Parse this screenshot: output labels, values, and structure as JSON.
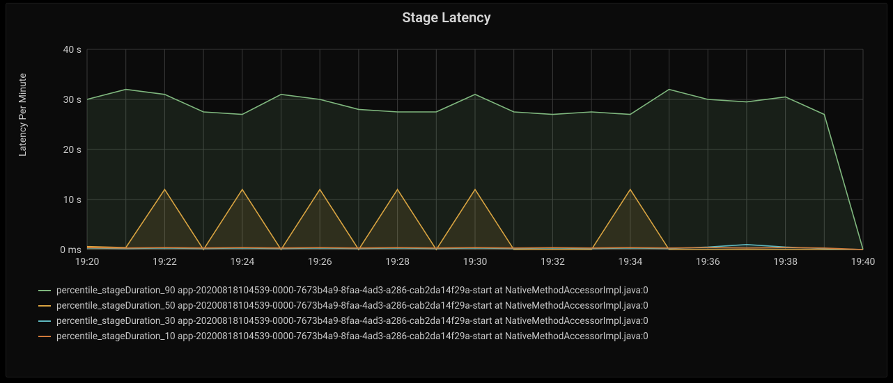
{
  "title": "Stage Latency",
  "ylabel": "Latency Per Minute",
  "chart_data": {
    "type": "area",
    "xlabel": "",
    "ylabel": "Latency Per Minute",
    "title": "Stage Latency",
    "x_ticks": [
      "19:20",
      "19:22",
      "19:24",
      "19:26",
      "19:28",
      "19:30",
      "19:32",
      "19:34",
      "19:36",
      "19:38",
      "19:40"
    ],
    "y_ticks": [
      "0 ms",
      "10 s",
      "20 s",
      "30 s",
      "40 s"
    ],
    "ylim": [
      0,
      40
    ],
    "x": [
      "19:20",
      "19:21",
      "19:22",
      "19:23",
      "19:24",
      "19:25",
      "19:26",
      "19:27",
      "19:28",
      "19:29",
      "19:30",
      "19:31",
      "19:32",
      "19:33",
      "19:34",
      "19:35",
      "19:36",
      "19:37",
      "19:38",
      "19:39",
      "19:40"
    ],
    "series": [
      {
        "name": "percentile_stageDuration_90 app-20200818104539-0000-7673b4a9-8faa-4ad3-a286-cab2da14f29a-start at NativeMethodAccessorImpl.java:0",
        "color": "#7fb77e",
        "values": [
          30,
          32,
          31,
          27.5,
          27,
          31,
          30,
          28,
          27.5,
          27.5,
          31,
          27.5,
          27,
          27.5,
          27,
          32,
          30,
          29.5,
          30.5,
          27,
          0
        ]
      },
      {
        "name": "percentile_stageDuration_50 app-20200818104539-0000-7673b4a9-8faa-4ad3-a286-cab2da14f29a-start at NativeMethodAccessorImpl.java:0",
        "color": "#d9a441",
        "values": [
          0.6,
          0.4,
          12,
          0,
          12,
          0,
          12,
          0,
          12,
          0,
          12,
          0,
          0,
          0,
          12,
          0,
          0,
          0,
          0,
          0,
          0
        ]
      },
      {
        "name": "percentile_stageDuration_30 app-20200818104539-0000-7673b4a9-8faa-4ad3-a286-cab2da14f29a-start at NativeMethodAccessorImpl.java:0",
        "color": "#5fb8bf",
        "values": [
          0.3,
          0.2,
          0.3,
          0.2,
          0.3,
          0.2,
          0.3,
          0.2,
          0.3,
          0.2,
          0.3,
          0.2,
          0.3,
          0.2,
          0.3,
          0.2,
          0.5,
          1,
          0.5,
          0.2,
          0
        ]
      },
      {
        "name": "percentile_stageDuration_10 app-20200818104539-0000-7673b4a9-8faa-4ad3-a286-cab2da14f29a-start at NativeMethodAccessorImpl.java:0",
        "color": "#d17a3a",
        "values": [
          0.4,
          0.3,
          0.4,
          0.3,
          0.4,
          0.3,
          0.4,
          0.3,
          0.4,
          0.3,
          0.4,
          0.3,
          0.4,
          0.3,
          0.4,
          0.3,
          0.4,
          0.3,
          0.4,
          0.3,
          0
        ]
      }
    ]
  },
  "legend": [
    {
      "color": "#7fb77e",
      "label": "percentile_stageDuration_90 app-20200818104539-0000-7673b4a9-8faa-4ad3-a286-cab2da14f29a-start at NativeMethodAccessorImpl.java:0"
    },
    {
      "color": "#d9a441",
      "label": "percentile_stageDuration_50 app-20200818104539-0000-7673b4a9-8faa-4ad3-a286-cab2da14f29a-start at NativeMethodAccessorImpl.java:0"
    },
    {
      "color": "#5fb8bf",
      "label": "percentile_stageDuration_30 app-20200818104539-0000-7673b4a9-8faa-4ad3-a286-cab2da14f29a-start at NativeMethodAccessorImpl.java:0"
    },
    {
      "color": "#d17a3a",
      "label": "percentile_stageDuration_10 app-20200818104539-0000-7673b4a9-8faa-4ad3-a286-cab2da14f29a-start at NativeMethodAccessorImpl.java:0"
    }
  ]
}
